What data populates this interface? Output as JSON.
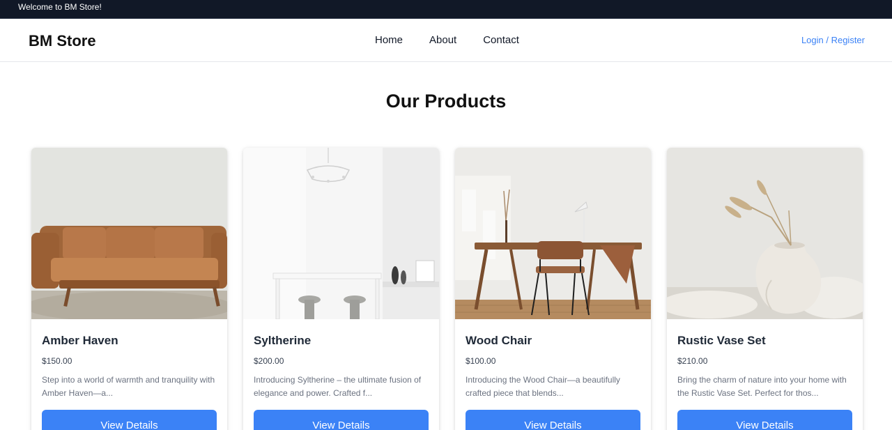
{
  "topbar": {
    "welcome": "Welcome to BM Store!"
  },
  "header": {
    "brand": "BM Store",
    "nav": [
      "Home",
      "About",
      "Contact"
    ],
    "login": "Login / Register"
  },
  "main": {
    "title": "Our Products",
    "products": [
      {
        "name": "Amber Haven",
        "price": "$150.00",
        "description": "Step into a world of warmth and tranquility with Amber Haven—a...",
        "button": "View Details",
        "image": "leather-sofa"
      },
      {
        "name": "Syltherine",
        "price": "$200.00",
        "description": "Introducing Syltherine – the ultimate fusion of elegance and power. Crafted f...",
        "button": "View Details",
        "image": "white-dining-room"
      },
      {
        "name": "Wood Chair",
        "price": "$100.00",
        "description": "Introducing the Wood Chair—a beautifully crafted piece that blends...",
        "button": "View Details",
        "image": "wooden-desk-chair"
      },
      {
        "name": "Rustic Vase Set",
        "price": "$210.00",
        "description": "Bring the charm of nature into your home with the Rustic Vase Set. Perfect for thos...",
        "button": "View Details",
        "image": "ceramic-vase"
      }
    ]
  },
  "colors": {
    "topbar_bg": "#111827",
    "accent": "#3b82f6",
    "text_dark": "#111827",
    "text_muted": "#6b7280"
  }
}
